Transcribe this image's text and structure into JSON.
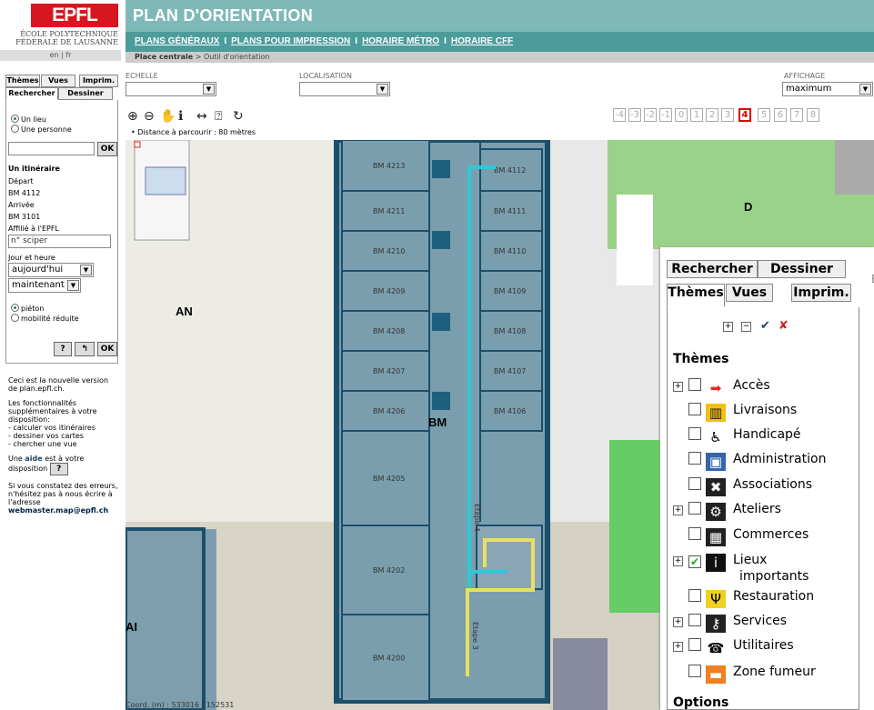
{
  "header": {
    "logo": "EPFL",
    "logo_sub_1": "ÉCOLE POLYTECHNIQUE",
    "logo_sub_2": "FÉDÉRALE DE LAUSANNE",
    "lang": "en | fr",
    "title": "PLAN D'ORIENTATION",
    "nav": [
      "PLANS GÉNÉRAUX",
      "PLANS POUR IMPRESSION",
      "HORAIRE MÉTRO",
      "HORAIRE CFF"
    ],
    "nav_sep": "I",
    "breadcrumb_home": "Place centrale",
    "breadcrumb_sep": ">",
    "breadcrumb_current": "Outil d'orientation"
  },
  "left_panel": {
    "tabs_row1": [
      "Thèmes",
      "Vues",
      "Imprim."
    ],
    "tabs_row2": [
      "Rechercher",
      "Dessiner"
    ],
    "radio_lieu": "Un lieu",
    "radio_personne": "Une personne",
    "search_value": "",
    "ok": "OK",
    "itin_title": "Un itinéraire",
    "depart_label": "Départ",
    "depart_value": "BM 4112",
    "arrivee_label": "Arrivée",
    "arrivee_value": "BM 3101",
    "affilie_label": "Affilié à l'EPFL",
    "sciper_placeholder": "n° sciper",
    "jour_label": "Jour et heure",
    "jour_value": "aujourd'hui",
    "heure_value": "maintenant",
    "radio_pieton": "piéton",
    "radio_mobilite": "mobilité réduite",
    "help_btn": "?",
    "back_btn": "↰",
    "ok_btn": "OK"
  },
  "info": {
    "p1": "Ceci est la nouvelle version de plan.epfl.ch.",
    "p2": "Les fonctionnalités supplémentaires à votre disposition:",
    "list": [
      "- calculer vos itinéraires",
      "- dessiner vos cartes",
      "- chercher une vue"
    ],
    "p3_pre": "Une ",
    "p3_link": "aide",
    "p3_post": " est à votre disposition",
    "p4": "Si vous constatez des erreurs, n'hésitez pas à nous écrire à l'adresse",
    "email": "webmaster.map@epfl.ch"
  },
  "toolbar": {
    "echelle_label": "ECHELLE",
    "echelle_value": "",
    "localisation_label": "LOCALISATION",
    "localisation_value": "",
    "affichage_label": "AFFICHAGE",
    "affichage_value": "maximum",
    "distance": "• Distance à parcourir : 80 mètres",
    "floors": [
      "-4",
      "-3",
      "-2",
      "-1",
      "0",
      "1",
      "2",
      "3",
      "4",
      "5",
      "6",
      "7",
      "8"
    ],
    "current_floor": "4"
  },
  "map": {
    "buildings": {
      "an": "AN",
      "bm": "BM",
      "d": "D",
      "ai": "AI"
    },
    "rooms_left": [
      "BM 4213",
      "BM 4211",
      "BM 4210",
      "BM 4209",
      "BM 4208",
      "BM 4207",
      "BM 4206",
      "BM 4205",
      "BM 4202",
      "BM 4200"
    ],
    "rooms_right": [
      "BM 4112",
      "BM 4111",
      "BM 4110",
      "BM 4109",
      "BM 4108",
      "BM 4107",
      "BM 4106"
    ],
    "etape4": "Etape 4",
    "etape3": "Etape 3",
    "coord": "Coord. (m) : 533016 / 152531",
    "colors": {
      "route_cyan": "#2cc8d8",
      "route_yellow": "#e8e060",
      "building": "#7a9eae",
      "wall": "#1b4f6b"
    }
  },
  "themes_panel": {
    "tabs_row1": [
      "Rechercher",
      "Dessiner"
    ],
    "tabs_row2": [
      "Thèmes",
      "Vues",
      "Imprim."
    ],
    "section": "Thèmes",
    "items": [
      {
        "label": "Accès",
        "expand": true,
        "checked": false,
        "icon": "arrow-right-icon"
      },
      {
        "label": "Livraisons",
        "expand": false,
        "checked": false,
        "icon": "delivery-icon"
      },
      {
        "label": "Handicapé",
        "expand": false,
        "checked": false,
        "icon": "wheelchair-icon"
      },
      {
        "label": "Administration",
        "expand": false,
        "checked": false,
        "icon": "admin-icon"
      },
      {
        "label": "Associations",
        "expand": false,
        "checked": false,
        "icon": "associations-icon"
      },
      {
        "label": "Ateliers",
        "expand": true,
        "checked": false,
        "icon": "workshop-icon"
      },
      {
        "label": "Commerces",
        "expand": false,
        "checked": false,
        "icon": "shops-icon"
      },
      {
        "label": "Lieux",
        "expand": true,
        "checked": true,
        "icon": "info-icon"
      },
      {
        "label": "importants",
        "expand": false,
        "checked": false,
        "icon": ""
      },
      {
        "label": "Restauration",
        "expand": false,
        "checked": false,
        "icon": "restaurant-icon"
      },
      {
        "label": "Services",
        "expand": true,
        "checked": false,
        "icon": "key-icon"
      },
      {
        "label": "Utilitaires",
        "expand": true,
        "checked": false,
        "icon": "phone-icon"
      },
      {
        "label": "Zone fumeur",
        "expand": false,
        "checked": false,
        "icon": "smoking-icon"
      }
    ],
    "options_title": "Options",
    "right_edge_text": "E"
  }
}
